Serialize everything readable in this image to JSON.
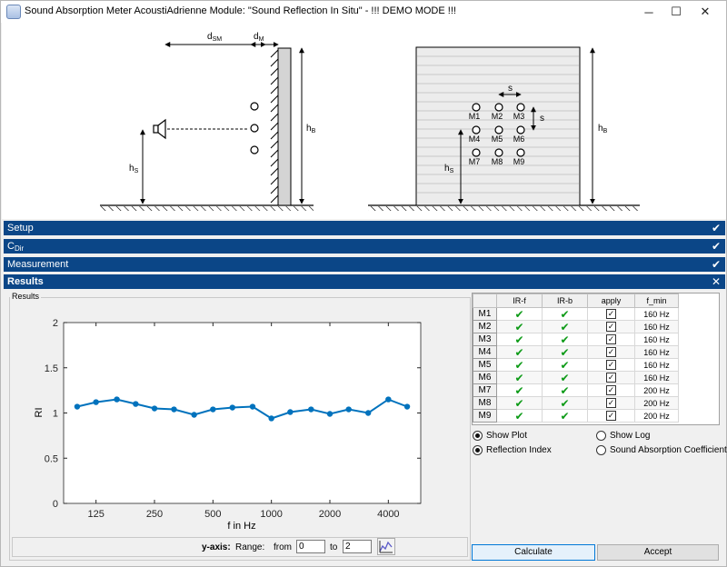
{
  "window": {
    "title": "Sound Absorption Meter AcoustiAdrienne Module: \"Sound Reflection In Situ\" - !!! DEMO MODE !!!",
    "controls": {
      "minimize": "─",
      "maximize": "☐",
      "close": "✕"
    }
  },
  "diagram": {
    "left": {
      "d_main": "d",
      "d_sub": "SM",
      "dm_main": "d",
      "dm_sub": "M",
      "hb_main": "h",
      "hb_sub": "B",
      "hs_main": "h",
      "hs_sub": "S"
    },
    "right": {
      "s_label": "s",
      "s_label2": "s",
      "hb_main": "h",
      "hb_sub": "B",
      "hs_main": "h",
      "hs_sub": "S",
      "mics": [
        "M1",
        "M2",
        "M3",
        "M4",
        "M5",
        "M6",
        "M7",
        "M8",
        "M9"
      ]
    }
  },
  "sections": {
    "setup": "Setup",
    "cdir_main": "C",
    "cdir_sub": "Dir",
    "measurement": "Measurement",
    "results": "Results",
    "check_icon": "✔",
    "close_icon": "✕"
  },
  "results": {
    "group_label": "Results",
    "yaxis_bar": {
      "label": "y-axis:",
      "range": "Range:",
      "from": "from",
      "to": "to",
      "from_value": "0",
      "to_value": "2"
    },
    "table": {
      "headers": [
        "",
        "IR-f",
        "IR-b",
        "apply",
        "f_min"
      ],
      "rows": [
        {
          "name": "M1",
          "f_min": "160 Hz"
        },
        {
          "name": "M2",
          "f_min": "160 Hz"
        },
        {
          "name": "M3",
          "f_min": "160 Hz"
        },
        {
          "name": "M4",
          "f_min": "160 Hz"
        },
        {
          "name": "M5",
          "f_min": "160 Hz"
        },
        {
          "name": "M6",
          "f_min": "160 Hz"
        },
        {
          "name": "M7",
          "f_min": "200 Hz"
        },
        {
          "name": "M8",
          "f_min": "200 Hz"
        },
        {
          "name": "M9",
          "f_min": "200 Hz"
        }
      ],
      "tick_icon": "✔",
      "check_mark": "✓"
    },
    "radios": {
      "show_plot": "Show Plot",
      "show_log": "Show Log",
      "reflection_index": "Reflection Index",
      "absorption": "Sound Absorption Coefficient"
    },
    "buttons": {
      "calculate": "Calculate",
      "accept": "Accept"
    }
  },
  "chart_data": {
    "type": "line",
    "xlabel": "f in Hz",
    "ylabel": "RI",
    "x": [
      100,
      125,
      160,
      200,
      250,
      315,
      400,
      500,
      630,
      800,
      1000,
      1250,
      1600,
      2000,
      2500,
      3150,
      4000,
      5000
    ],
    "x_scale": "log",
    "xticks": [
      "125",
      "250",
      "500",
      "1000",
      "2000",
      "4000"
    ],
    "ylim": [
      0,
      2
    ],
    "yticks": [
      "0",
      "0.5",
      "1",
      "1.5",
      "2"
    ],
    "series": [
      {
        "values": [
          1.07,
          1.12,
          1.15,
          1.1,
          1.05,
          1.04,
          0.98,
          1.04,
          1.06,
          1.07,
          0.94,
          1.01,
          1.04,
          0.99,
          1.04,
          1.0,
          1.15,
          1.07
        ],
        "color": "#0072bd"
      }
    ],
    "grid": false
  }
}
